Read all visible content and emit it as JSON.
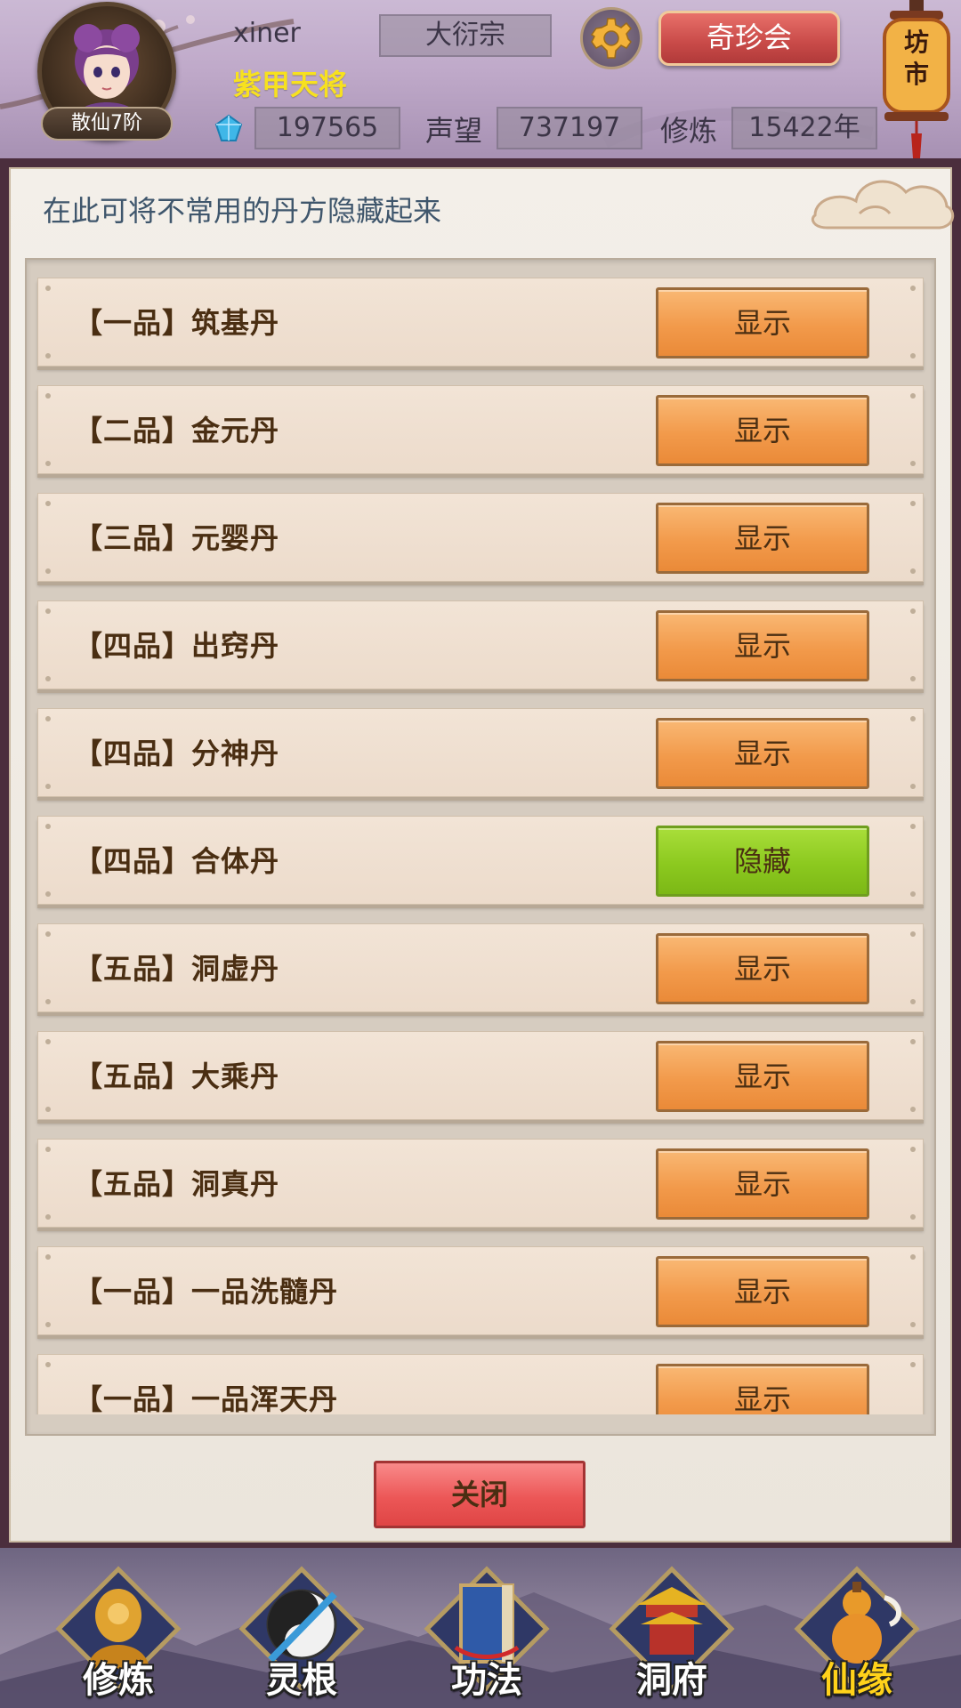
{
  "header": {
    "username": "xiner",
    "title": "紫甲天将",
    "sect": "大衍宗",
    "rank_badge": "散仙7阶",
    "qizhen_label": "奇珍会",
    "market_label": "坊市",
    "gems": "197565",
    "reputation_label": "声望",
    "reputation": "737197",
    "cultivation_label": "修炼",
    "cultivation": "15422年"
  },
  "panel": {
    "hint": "在此可将不常用的丹方隐藏起来",
    "rows": [
      {
        "grade": "【一品】",
        "name": "筑基丹",
        "button": "显示",
        "state": "show"
      },
      {
        "grade": "【二品】",
        "name": "金元丹",
        "button": "显示",
        "state": "show"
      },
      {
        "grade": "【三品】",
        "name": "元婴丹",
        "button": "显示",
        "state": "show"
      },
      {
        "grade": "【四品】",
        "name": "出窍丹",
        "button": "显示",
        "state": "show"
      },
      {
        "grade": "【四品】",
        "name": "分神丹",
        "button": "显示",
        "state": "show"
      },
      {
        "grade": "【四品】",
        "name": "合体丹",
        "button": "隐藏",
        "state": "hide"
      },
      {
        "grade": "【五品】",
        "name": "洞虚丹",
        "button": "显示",
        "state": "show"
      },
      {
        "grade": "【五品】",
        "name": "大乘丹",
        "button": "显示",
        "state": "show"
      },
      {
        "grade": "【五品】",
        "name": "洞真丹",
        "button": "显示",
        "state": "show"
      },
      {
        "grade": "【一品】",
        "name": "一品洗髓丹",
        "button": "显示",
        "state": "show"
      },
      {
        "grade": "【一品】",
        "name": "一品浑天丹",
        "button": "显示",
        "state": "show"
      }
    ],
    "close_label": "关闭"
  },
  "nav": [
    {
      "label": "修炼",
      "icon": "cultivate-icon",
      "active": false
    },
    {
      "label": "灵根",
      "icon": "spirit-root-icon",
      "active": false
    },
    {
      "label": "功法",
      "icon": "technique-book-icon",
      "active": false
    },
    {
      "label": "洞府",
      "icon": "cave-abode-icon",
      "active": false
    },
    {
      "label": "仙缘",
      "icon": "gourd-icon",
      "active": true
    }
  ],
  "colors": {
    "show_button": "#f29a4b",
    "hide_button": "#8cc91f",
    "close_button": "#ec5757",
    "title_yellow": "#f7e11f",
    "hint_text": "#3f566c"
  }
}
